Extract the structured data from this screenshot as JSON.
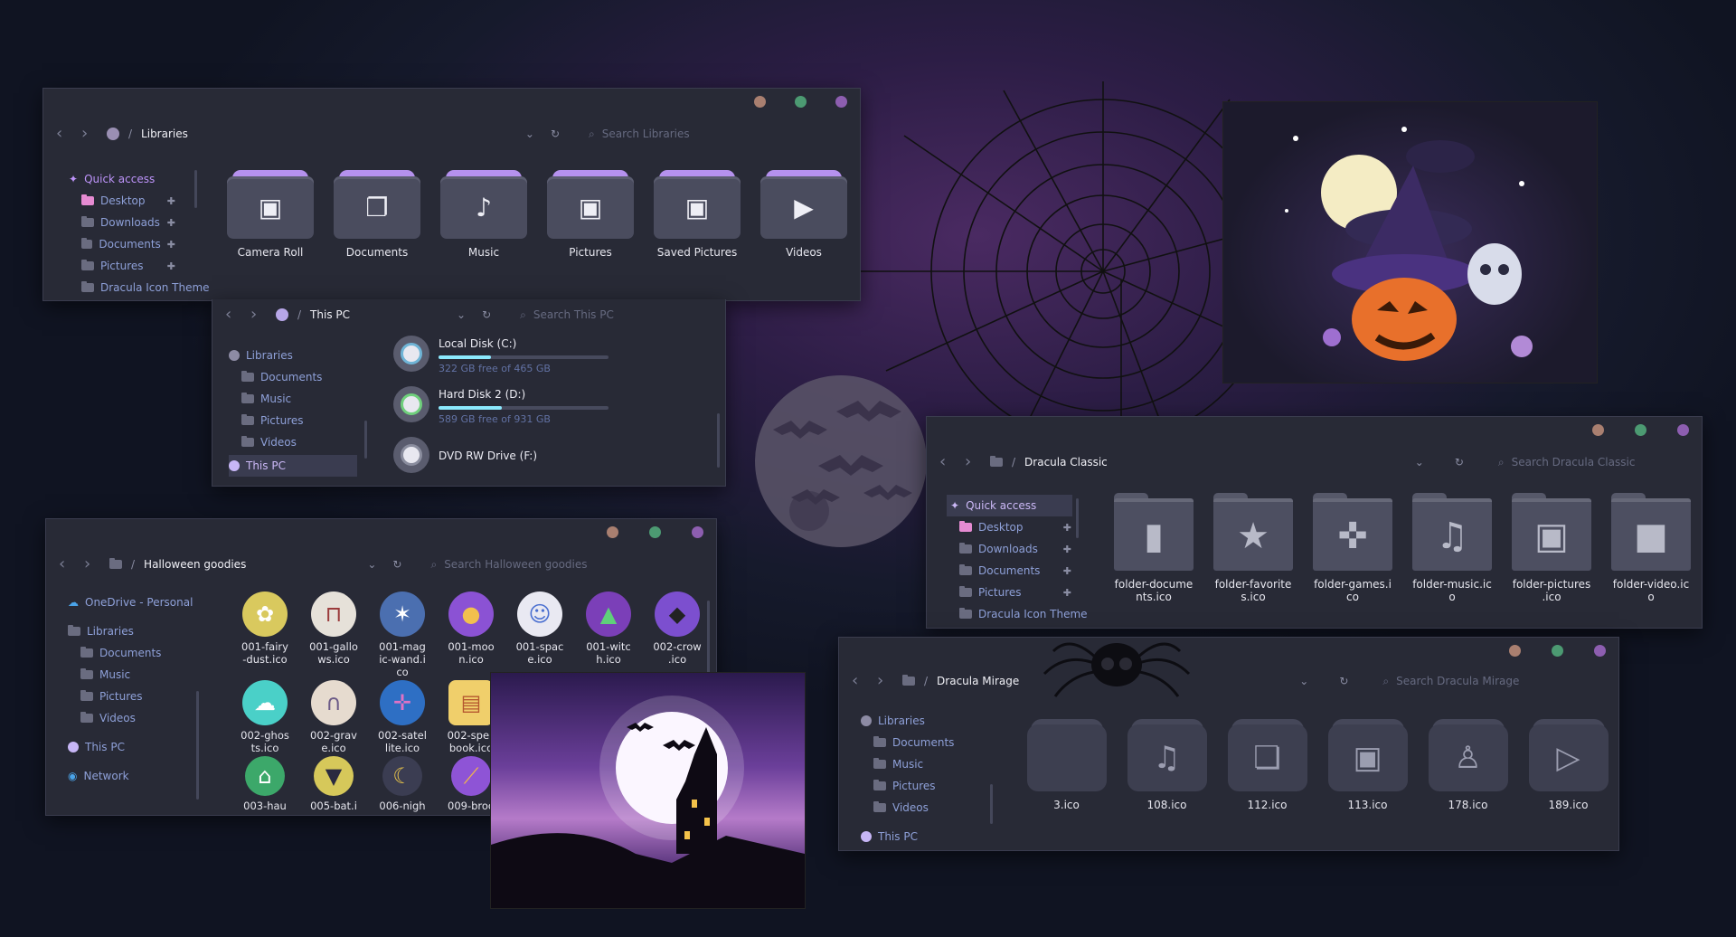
{
  "colors": {
    "accent": "#bd93f9",
    "dot_orange": "#a97f70",
    "dot_green": "#4c9a72",
    "dot_purple": "#8d5eb0",
    "link": "#6272a4"
  },
  "libraries_win": {
    "breadcrumb": "Libraries",
    "search_placeholder": "Search Libraries",
    "nav": [
      {
        "label": "Quick access"
      },
      {
        "label": "Desktop"
      },
      {
        "label": "Downloads"
      },
      {
        "label": "Documents"
      },
      {
        "label": "Pictures"
      },
      {
        "label": "Dracula Icon Theme"
      }
    ],
    "folders": [
      {
        "label": "Camera Roll",
        "icon": "image-icon"
      },
      {
        "label": "Documents",
        "icon": "document-icon"
      },
      {
        "label": "Music",
        "icon": "music-note-icon"
      },
      {
        "label": "Pictures",
        "icon": "image-icon"
      },
      {
        "label": "Saved Pictures",
        "icon": "image-icon"
      },
      {
        "label": "Videos",
        "icon": "play-icon"
      }
    ]
  },
  "thispc_win": {
    "breadcrumb": "This PC",
    "search_placeholder": "Search This PC",
    "nav": [
      {
        "label": "Libraries"
      },
      {
        "label": "Documents"
      },
      {
        "label": "Music"
      },
      {
        "label": "Pictures"
      },
      {
        "label": "Videos"
      },
      {
        "label": "This PC"
      }
    ],
    "drives": [
      {
        "name": "Local Disk (C:)",
        "free": "322 GB free of 465 GB",
        "used_fraction": 0.31
      },
      {
        "name": "Hard Disk 2 (D:)",
        "free": "589 GB free of 931 GB",
        "used_fraction": 0.37
      },
      {
        "name": "DVD RW Drive (F:)"
      }
    ]
  },
  "halloween_win": {
    "breadcrumb": "Halloween goodies",
    "search_placeholder": "Search Halloween goodies",
    "nav": [
      {
        "label": "OneDrive - Personal"
      },
      {
        "label": "Libraries"
      },
      {
        "label": "Documents"
      },
      {
        "label": "Music"
      },
      {
        "label": "Pictures"
      },
      {
        "label": "Videos"
      },
      {
        "label": "This PC"
      },
      {
        "label": "Network"
      }
    ],
    "row1": [
      {
        "line1": "001-fairy",
        "line2": "-dust.ico",
        "line3": "",
        "icon": "fairy-dust-icon",
        "color": "#d9c95e"
      },
      {
        "line1": "001-gallo",
        "line2": "ws.ico",
        "line3": "",
        "icon": "gallows-icon",
        "color": "#e6e1d9"
      },
      {
        "line1": "001-mag",
        "line2": "ic-wand.i",
        "line3": "co",
        "icon": "magic-wand-icon",
        "color": "#4b6fb0"
      },
      {
        "line1": "001-moo",
        "line2": "n.ico",
        "line3": "",
        "icon": "moon-icon",
        "color": "#8b52d4"
      },
      {
        "line1": "001-spac",
        "line2": "e.ico",
        "line3": "",
        "icon": "astronaut-icon",
        "color": "#e9e9f2"
      },
      {
        "line1": "001-witc",
        "line2": "h.ico",
        "line3": "",
        "icon": "witch-icon",
        "color": "#7b3fb8"
      },
      {
        "line1": "002-crow",
        "line2": ".ico",
        "line3": "",
        "icon": "crow-icon",
        "color": "#7c4fcf"
      }
    ],
    "row2": [
      {
        "line1": "002-ghos",
        "line2": "ts.ico",
        "icon": "ghosts-icon",
        "color": "#4ad0c8"
      },
      {
        "line1": "002-grav",
        "line2": "e.ico",
        "icon": "grave-icon",
        "color": "#e6dbcf"
      },
      {
        "line1": "002-satel",
        "line2": "lite.ico",
        "icon": "satellite-icon",
        "color": "#2e6fc4"
      },
      {
        "line1": "002-spell",
        "line2": "book.ico",
        "icon": "spellbook-icon",
        "color": "#f0cf6b"
      }
    ],
    "row3": [
      {
        "line1": "003-hau",
        "icon": "haunted-house-icon",
        "color": "#3ca86a"
      },
      {
        "line1": "005-bat.i",
        "icon": "bat-icon",
        "color": "#d6c85a"
      },
      {
        "line1": "006-nigh",
        "icon": "night-icon",
        "color": "#e7c34a"
      },
      {
        "line1": "009-broo",
        "icon": "broom-icon",
        "color": "#8e54d6"
      }
    ]
  },
  "classic_win": {
    "breadcrumb": "Dracula Classic",
    "search_placeholder": "Search Dracula Classic",
    "nav": [
      {
        "label": "Quick access"
      },
      {
        "label": "Desktop"
      },
      {
        "label": "Downloads"
      },
      {
        "label": "Documents"
      },
      {
        "label": "Pictures"
      },
      {
        "label": "Dracula Icon Theme"
      }
    ],
    "folders": [
      {
        "line1": "folder-docume",
        "line2": "nts.ico",
        "icon": "document-icon"
      },
      {
        "line1": "folder-favorite",
        "line2": "s.ico",
        "icon": "star-icon"
      },
      {
        "line1": "folder-games.i",
        "line2": "co",
        "icon": "gamepad-icon"
      },
      {
        "line1": "folder-music.ic",
        "line2": "o",
        "icon": "music-note-icon"
      },
      {
        "line1": "folder-pictures",
        "line2": ".ico",
        "icon": "image-icon"
      },
      {
        "line1": "folder-video.ic",
        "line2": "o",
        "icon": "video-camera-icon"
      }
    ]
  },
  "mirage_win": {
    "breadcrumb": "Dracula Mirage",
    "search_placeholder": "Search Dracula Mirage",
    "nav": [
      {
        "label": "Libraries"
      },
      {
        "label": "Documents"
      },
      {
        "label": "Music"
      },
      {
        "label": "Pictures"
      },
      {
        "label": "Videos"
      },
      {
        "label": "This PC"
      }
    ],
    "folders": [
      {
        "label": "3.ico",
        "icon": ""
      },
      {
        "label": "108.ico",
        "icon": "music-note-icon"
      },
      {
        "label": "112.ico",
        "icon": "document-icon"
      },
      {
        "label": "113.ico",
        "icon": "image-icon"
      },
      {
        "label": "178.ico",
        "icon": "user-icon"
      },
      {
        "label": "189.ico",
        "icon": "play-icon"
      }
    ]
  }
}
